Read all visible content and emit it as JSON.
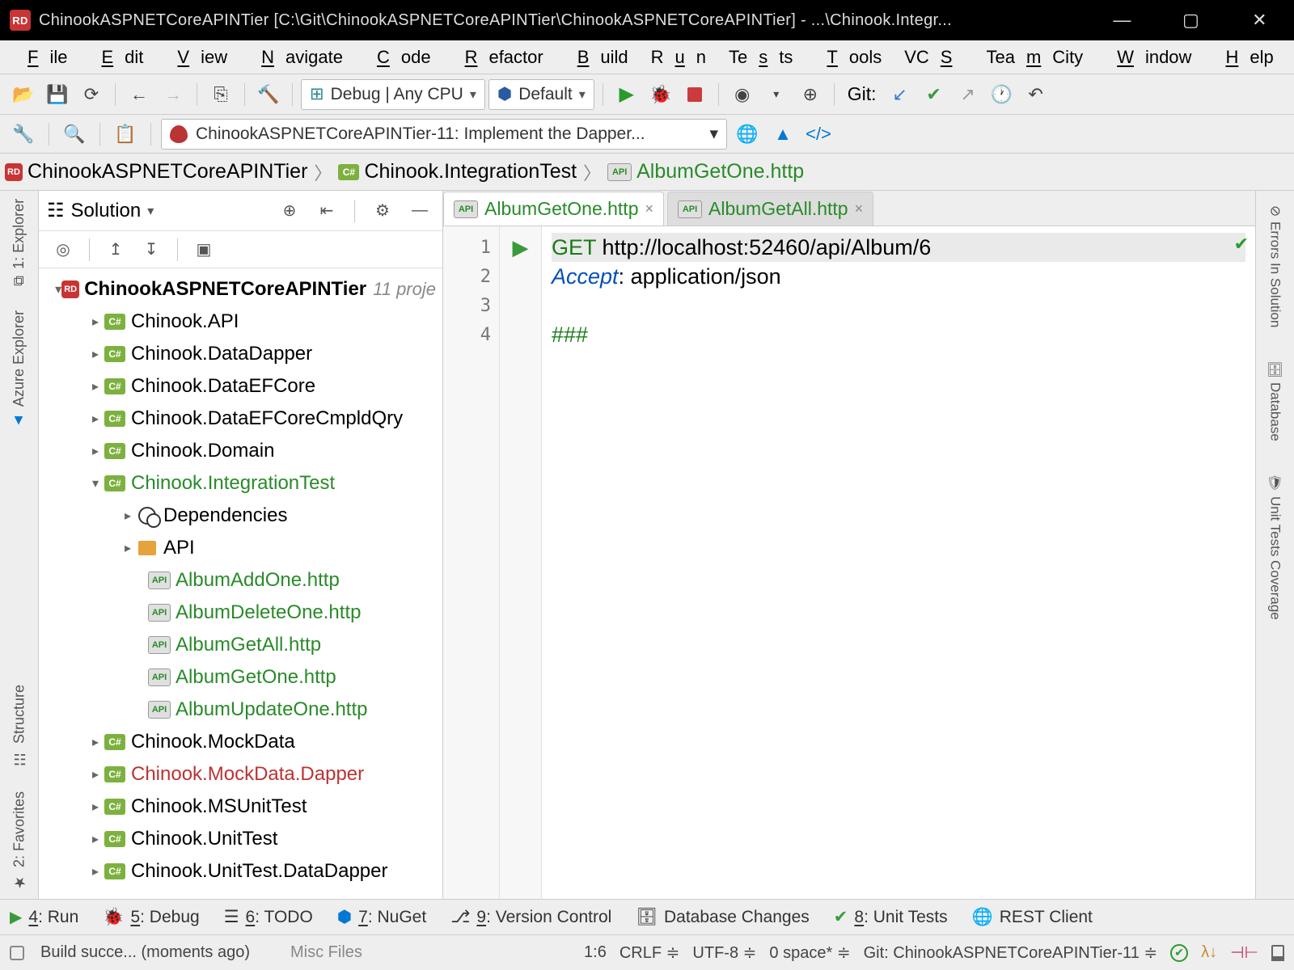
{
  "titlebar": {
    "icon": "RD",
    "title": "ChinookASPNETCoreAPINTier [C:\\Git\\ChinookASPNETCoreAPINTier\\ChinookASPNETCoreAPINTier] - ...\\Chinook.Integr..."
  },
  "menu": {
    "file": "File",
    "edit": "Edit",
    "view": "View",
    "navigate": "Navigate",
    "code": "Code",
    "refactor": "Refactor",
    "build": "Build",
    "run": "Run",
    "tests": "Tests",
    "tools": "Tools",
    "vcs": "VCS",
    "teamcity": "TeamCity",
    "window": "Window",
    "help": "Help"
  },
  "toolbar": {
    "config_label": "Debug | Any CPU",
    "target_label": "Default",
    "git_label": "Git:"
  },
  "toolbar2": {
    "run_config": "ChinookASPNETCoreAPINTier-11: Implement the Dapper..."
  },
  "breadcrumb": {
    "root": "ChinookASPNETCoreAPINTier",
    "mid": "Chinook.IntegrationTest",
    "leaf": "AlbumGetOne.http"
  },
  "explorer": {
    "title": "Solution",
    "root": "ChinookASPNETCoreAPINTier",
    "root_meta": "11 proje",
    "items": [
      {
        "label": "Chinook.API",
        "pad": 1
      },
      {
        "label": "Chinook.DataDapper",
        "pad": 1
      },
      {
        "label": "Chinook.DataEFCore",
        "pad": 1
      },
      {
        "label": "Chinook.DataEFCoreCmpldQry",
        "pad": 1
      },
      {
        "label": "Chinook.Domain",
        "pad": 1
      }
    ],
    "integration": "Chinook.IntegrationTest",
    "deps": "Dependencies",
    "api_folder": "API",
    "api_files": [
      "AlbumAddOne.http",
      "AlbumDeleteOne.http",
      "AlbumGetAll.http",
      "AlbumGetOne.http",
      "AlbumUpdateOne.http"
    ],
    "after": [
      {
        "label": "Chinook.MockData",
        "cls": ""
      },
      {
        "label": "Chinook.MockData.Dapper",
        "cls": "red"
      },
      {
        "label": "Chinook.MSUnitTest",
        "cls": ""
      },
      {
        "label": "Chinook.UnitTest",
        "cls": ""
      },
      {
        "label": "Chinook.UnitTest.DataDapper",
        "cls": ""
      }
    ]
  },
  "tabs": {
    "active": "AlbumGetOne.http",
    "other": "AlbumGetAll.http"
  },
  "code": {
    "method": "GET",
    "url": "http://localhost:52460/api/Album/6",
    "accept_key": "Accept",
    "accept_val": "application/json",
    "sep": "###",
    "lines": [
      "1",
      "2",
      "3",
      "4"
    ]
  },
  "left_tools": {
    "explorer": "1: Explorer",
    "azure": "Azure Explorer",
    "structure": "Structure",
    "fav": "2: Favorites"
  },
  "right_tools": {
    "errors": "Errors In Solution",
    "database": "Database",
    "unit": "Unit Tests Coverage"
  },
  "bottom": {
    "run": "4: Run",
    "debug": "5: Debug",
    "todo": "6: TODO",
    "nuget": "7: NuGet",
    "vcs": "9: Version Control",
    "db": "Database Changes",
    "unit": "8: Unit Tests",
    "rest": "REST Client"
  },
  "status": {
    "build": "Build succe... (moments ago)",
    "misc": "Misc Files",
    "pos": "1:6",
    "lineend": "CRLF",
    "enc": "UTF-8",
    "indent": "0 space*",
    "git": "Git: ChinookASPNETCoreAPINTier-11"
  }
}
